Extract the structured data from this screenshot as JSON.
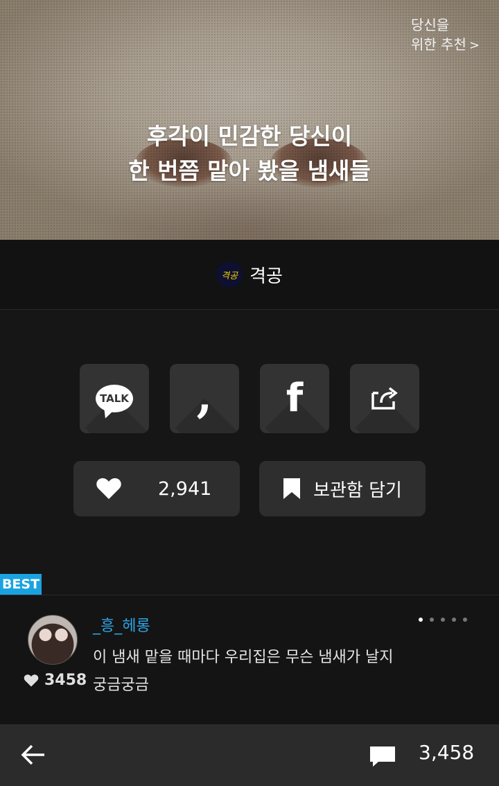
{
  "hero": {
    "recommend_line1": "당신을",
    "recommend_line2": "위한 추천",
    "recommend_chevron": ">",
    "title_line1": "후각이 민감한 당신이",
    "title_line2": "한 번쯤 맡아 봤을 냄새들"
  },
  "author": {
    "logo_text": "격공",
    "name": "격공"
  },
  "share": {
    "buttons": [
      {
        "icon": "kakaotalk-icon",
        "glyph": "TALK"
      },
      {
        "icon": "kakaostory-icon",
        "glyph": ","
      },
      {
        "icon": "facebook-icon",
        "glyph": "f"
      },
      {
        "icon": "share-icon",
        "glyph": ""
      }
    ]
  },
  "actions": {
    "like_count": "2,941",
    "save_label": "보관함 담기"
  },
  "best_comment": {
    "badge": "BEST",
    "username": "_흥_헤롱",
    "text": "이 냄새 맡을 때마다 우리집은 무슨 냄새가 날지 궁금궁금",
    "likes": "3458",
    "page_dots": 5,
    "active_dot": 1
  },
  "bottom_bar": {
    "comment_count": "3,458"
  },
  "colors": {
    "accent": "#1aa3e0",
    "username": "#2fa5e6",
    "background": "#161616",
    "button": "#333333"
  }
}
